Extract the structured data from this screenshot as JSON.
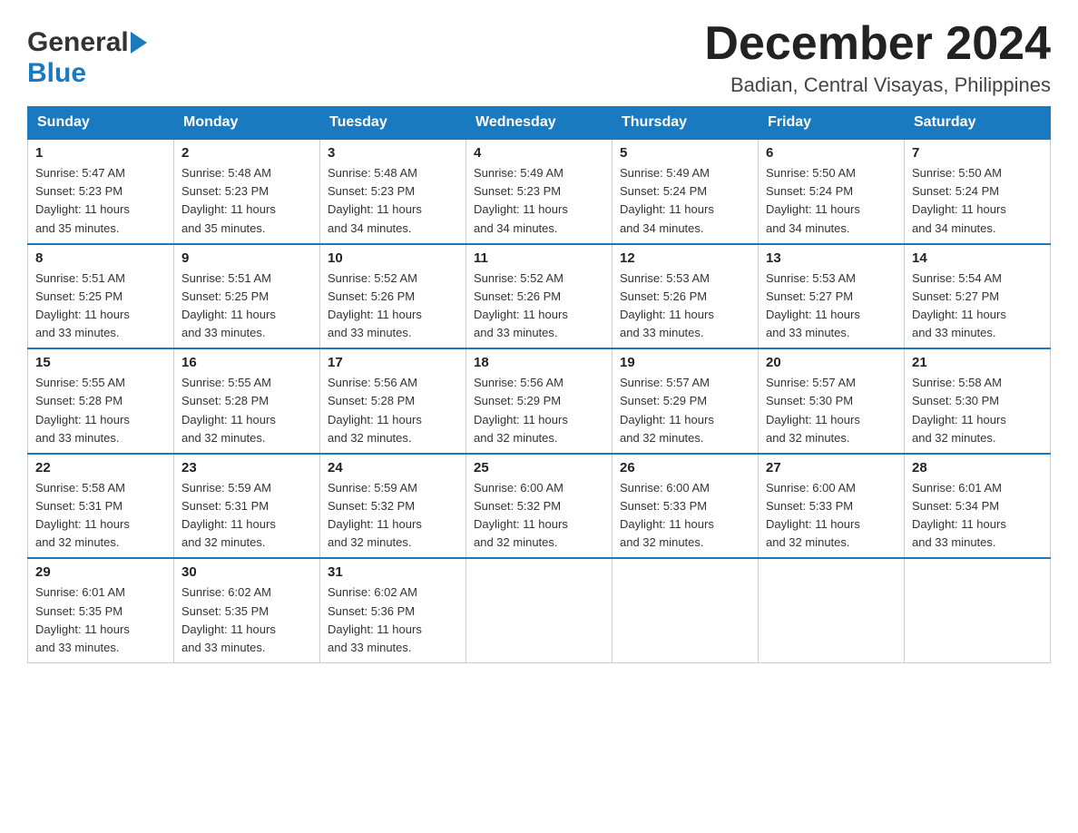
{
  "header": {
    "logo_general": "General",
    "logo_blue": "Blue",
    "month_title": "December 2024",
    "location": "Badian, Central Visayas, Philippines"
  },
  "days_of_week": [
    "Sunday",
    "Monday",
    "Tuesday",
    "Wednesday",
    "Thursday",
    "Friday",
    "Saturday"
  ],
  "weeks": [
    [
      {
        "day": "1",
        "sunrise": "5:47 AM",
        "sunset": "5:23 PM",
        "daylight": "11 hours and 35 minutes."
      },
      {
        "day": "2",
        "sunrise": "5:48 AM",
        "sunset": "5:23 PM",
        "daylight": "11 hours and 35 minutes."
      },
      {
        "day": "3",
        "sunrise": "5:48 AM",
        "sunset": "5:23 PM",
        "daylight": "11 hours and 34 minutes."
      },
      {
        "day": "4",
        "sunrise": "5:49 AM",
        "sunset": "5:23 PM",
        "daylight": "11 hours and 34 minutes."
      },
      {
        "day": "5",
        "sunrise": "5:49 AM",
        "sunset": "5:24 PM",
        "daylight": "11 hours and 34 minutes."
      },
      {
        "day": "6",
        "sunrise": "5:50 AM",
        "sunset": "5:24 PM",
        "daylight": "11 hours and 34 minutes."
      },
      {
        "day": "7",
        "sunrise": "5:50 AM",
        "sunset": "5:24 PM",
        "daylight": "11 hours and 34 minutes."
      }
    ],
    [
      {
        "day": "8",
        "sunrise": "5:51 AM",
        "sunset": "5:25 PM",
        "daylight": "11 hours and 33 minutes."
      },
      {
        "day": "9",
        "sunrise": "5:51 AM",
        "sunset": "5:25 PM",
        "daylight": "11 hours and 33 minutes."
      },
      {
        "day": "10",
        "sunrise": "5:52 AM",
        "sunset": "5:26 PM",
        "daylight": "11 hours and 33 minutes."
      },
      {
        "day": "11",
        "sunrise": "5:52 AM",
        "sunset": "5:26 PM",
        "daylight": "11 hours and 33 minutes."
      },
      {
        "day": "12",
        "sunrise": "5:53 AM",
        "sunset": "5:26 PM",
        "daylight": "11 hours and 33 minutes."
      },
      {
        "day": "13",
        "sunrise": "5:53 AM",
        "sunset": "5:27 PM",
        "daylight": "11 hours and 33 minutes."
      },
      {
        "day": "14",
        "sunrise": "5:54 AM",
        "sunset": "5:27 PM",
        "daylight": "11 hours and 33 minutes."
      }
    ],
    [
      {
        "day": "15",
        "sunrise": "5:55 AM",
        "sunset": "5:28 PM",
        "daylight": "11 hours and 33 minutes."
      },
      {
        "day": "16",
        "sunrise": "5:55 AM",
        "sunset": "5:28 PM",
        "daylight": "11 hours and 32 minutes."
      },
      {
        "day": "17",
        "sunrise": "5:56 AM",
        "sunset": "5:28 PM",
        "daylight": "11 hours and 32 minutes."
      },
      {
        "day": "18",
        "sunrise": "5:56 AM",
        "sunset": "5:29 PM",
        "daylight": "11 hours and 32 minutes."
      },
      {
        "day": "19",
        "sunrise": "5:57 AM",
        "sunset": "5:29 PM",
        "daylight": "11 hours and 32 minutes."
      },
      {
        "day": "20",
        "sunrise": "5:57 AM",
        "sunset": "5:30 PM",
        "daylight": "11 hours and 32 minutes."
      },
      {
        "day": "21",
        "sunrise": "5:58 AM",
        "sunset": "5:30 PM",
        "daylight": "11 hours and 32 minutes."
      }
    ],
    [
      {
        "day": "22",
        "sunrise": "5:58 AM",
        "sunset": "5:31 PM",
        "daylight": "11 hours and 32 minutes."
      },
      {
        "day": "23",
        "sunrise": "5:59 AM",
        "sunset": "5:31 PM",
        "daylight": "11 hours and 32 minutes."
      },
      {
        "day": "24",
        "sunrise": "5:59 AM",
        "sunset": "5:32 PM",
        "daylight": "11 hours and 32 minutes."
      },
      {
        "day": "25",
        "sunrise": "6:00 AM",
        "sunset": "5:32 PM",
        "daylight": "11 hours and 32 minutes."
      },
      {
        "day": "26",
        "sunrise": "6:00 AM",
        "sunset": "5:33 PM",
        "daylight": "11 hours and 32 minutes."
      },
      {
        "day": "27",
        "sunrise": "6:00 AM",
        "sunset": "5:33 PM",
        "daylight": "11 hours and 32 minutes."
      },
      {
        "day": "28",
        "sunrise": "6:01 AM",
        "sunset": "5:34 PM",
        "daylight": "11 hours and 33 minutes."
      }
    ],
    [
      {
        "day": "29",
        "sunrise": "6:01 AM",
        "sunset": "5:35 PM",
        "daylight": "11 hours and 33 minutes."
      },
      {
        "day": "30",
        "sunrise": "6:02 AM",
        "sunset": "5:35 PM",
        "daylight": "11 hours and 33 minutes."
      },
      {
        "day": "31",
        "sunrise": "6:02 AM",
        "sunset": "5:36 PM",
        "daylight": "11 hours and 33 minutes."
      },
      null,
      null,
      null,
      null
    ]
  ],
  "labels": {
    "sunrise": "Sunrise:",
    "sunset": "Sunset:",
    "daylight": "Daylight:"
  }
}
